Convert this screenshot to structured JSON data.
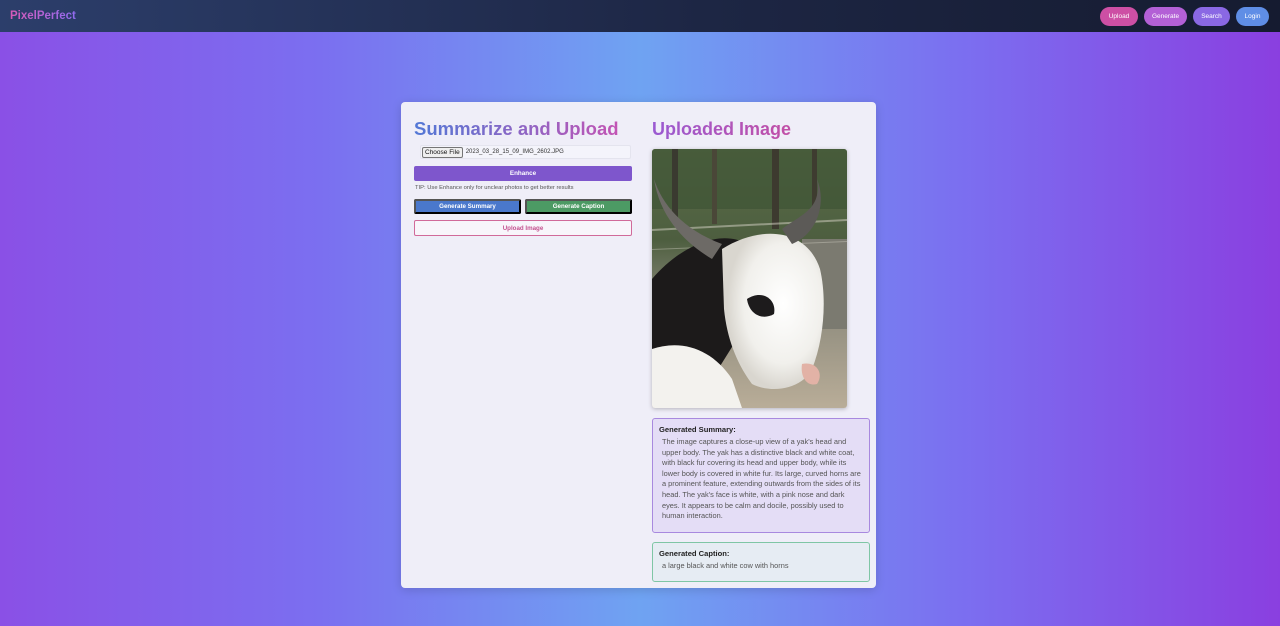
{
  "navbar": {
    "brand": "PixelPerfect",
    "buttons": [
      {
        "label": "Upload"
      },
      {
        "label": "Generate"
      },
      {
        "label": "Search"
      },
      {
        "label": "Login"
      }
    ]
  },
  "left_panel": {
    "title": "Summarize and Upload",
    "file_input": {
      "button_label": "Choose File",
      "file_name": "2023_03_28_15_09_IMG_2602.JPG"
    },
    "enhance_label": "Enhance",
    "tip": "TIP: Use Enhance only for unclear photos to get better results",
    "generate_summary_label": "Generate Summary",
    "generate_caption_label": "Generate Caption",
    "upload_image_label": "Upload Image"
  },
  "right_panel": {
    "title": "Uploaded Image",
    "summary": {
      "heading": "Generated Summary:",
      "text": "The image captures a close-up view of a yak's head and upper body. The yak has a distinctive black and white coat, with black fur covering its head and upper body, while its lower body is covered in white fur. Its large, curved horns are a prominent feature, extending outwards from the sides of its head. The yak's face is white, with a pink nose and dark eyes. It appears to be calm and docile, possibly used to human interaction."
    },
    "caption": {
      "heading": "Generated Caption:",
      "text": "a large black and white cow with horns"
    }
  }
}
